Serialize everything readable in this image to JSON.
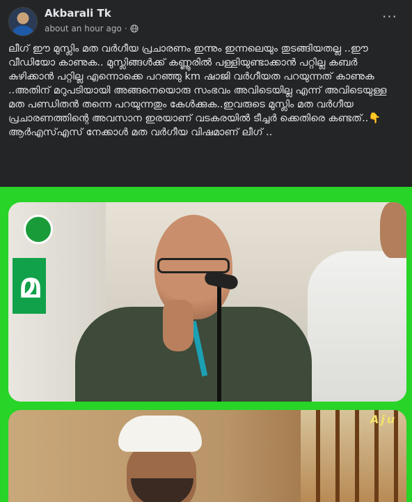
{
  "post": {
    "author": "Akbarali Tk",
    "timestamp": "about an hour ago",
    "separator": "·",
    "privacy_icon": "globe-icon",
    "more_label": "···",
    "text": "ലീഗ് ഈ മുസ്ലിം മത വർഗീയ പ്രചാരണം ഇന്നും ഇന്നലെയും തുടങ്ങിയതല്ല ..ഈ വീഡിയോ കാണുക.. മുസ്ലിങ്ങൾക്ക് കണ്ണൂരിൽ പള്ളിയുണ്ടാക്കാൻ പറ്റില്ല കബർ കുഴിക്കാൻ പറ്റില്ല എന്നൊക്കെ പറഞ്ഞു km ഷാജി വർഗീയത പറയുന്നത് കാണുക ..അതിന് മറുപടിയായി അങ്ങനെയൊരു സംഭവം അവിടെയില്ല എന്ന് അവിടെയുള്ള മത പണ്ഡിതൻ തന്നെ പറയുന്നതും കേൾക്കുക..ഇവരുടെ മുസ്ലിം മത വർഗീയ പ്രചാരണത്തിന്റെ അവസാന ഇരയാണ് വടകരയിൽ ടീച്ചർ ക്കെതിരെ കണ്ടത്..👇\nആർഎസ്എസ് നേക്കാൾ മത വർഗീയ വിഷമാണ് ലീഗ് .."
  },
  "media": {
    "banner_char": "മ",
    "watermark": "Aju"
  },
  "colors": {
    "background": "#242526",
    "text": "#e4e6eb",
    "secondary": "#b0b3b8",
    "media_green": "#27d427"
  }
}
